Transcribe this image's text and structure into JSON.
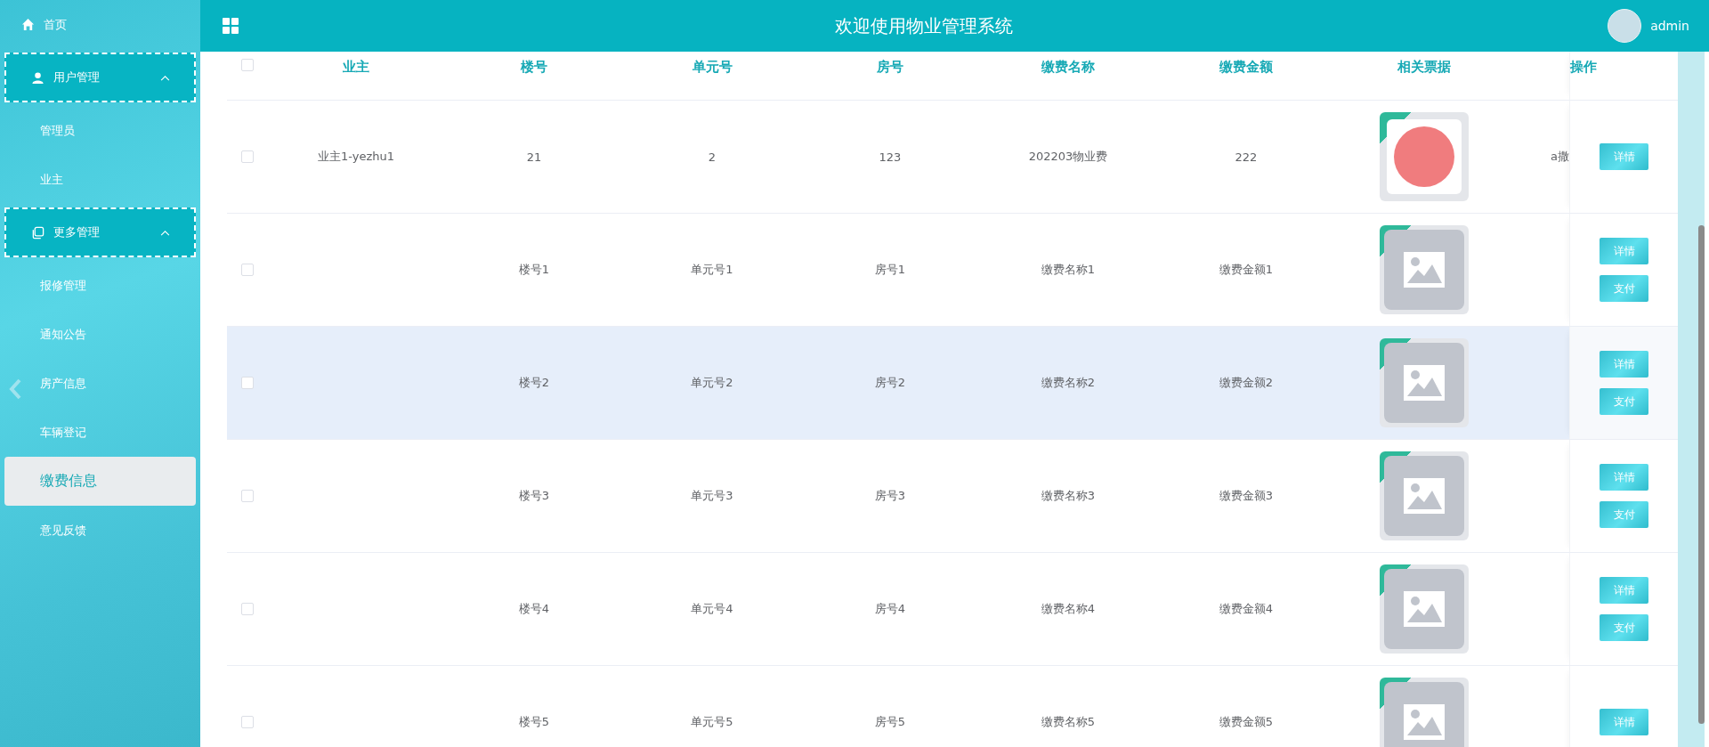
{
  "sidebar": {
    "home": {
      "label": "首页"
    },
    "groups": [
      {
        "label": "用户管理",
        "expanded": true,
        "children": [
          {
            "label": "管理员",
            "selected": false
          },
          {
            "label": "业主",
            "selected": false
          }
        ]
      },
      {
        "label": "更多管理",
        "expanded": true,
        "children": [
          {
            "label": "报修管理",
            "selected": false
          },
          {
            "label": "通知公告",
            "selected": false
          },
          {
            "label": "房产信息",
            "selected": false
          },
          {
            "label": "车辆登记",
            "selected": false
          },
          {
            "label": "缴费信息",
            "selected": true
          },
          {
            "label": "意见反馈",
            "selected": false
          }
        ]
      }
    ]
  },
  "header": {
    "title": "欢迎使用物业管理系统",
    "user": "admin"
  },
  "table": {
    "select_all": {
      "checked": false
    },
    "columns": [
      "业主",
      "楼号",
      "单元号",
      "房号",
      "缴费名称",
      "缴费金额",
      "相关票据"
    ],
    "action_column": "操作",
    "rows": [
      {
        "checked": false,
        "highlighted": false,
        "cells": [
          "业主1-yezhu1",
          "21",
          "2",
          "123",
          "202203物业费",
          "222"
        ],
        "receipt_uploaded": true,
        "column_9": "a撒",
        "actions": [
          "详情"
        ]
      },
      {
        "checked": false,
        "highlighted": false,
        "cells": [
          "",
          "楼号1",
          "单元号1",
          "房号1",
          "缴费名称1",
          "缴费金额1"
        ],
        "receipt_uploaded": false,
        "actions": [
          "详情",
          "支付"
        ]
      },
      {
        "checked": false,
        "highlighted": true,
        "cells": [
          "",
          "楼号2",
          "单元号2",
          "房号2",
          "缴费名称2",
          "缴费金额2"
        ],
        "receipt_uploaded": false,
        "actions": [
          "详情",
          "支付"
        ]
      },
      {
        "checked": false,
        "highlighted": false,
        "cells": [
          "",
          "楼号3",
          "单元号3",
          "房号3",
          "缴费名称3",
          "缴费金额3"
        ],
        "receipt_uploaded": false,
        "actions": [
          "详情",
          "支付"
        ]
      },
      {
        "checked": false,
        "highlighted": false,
        "cells": [
          "",
          "楼号4",
          "单元号4",
          "房号4",
          "缴费名称4",
          "缴费金额4"
        ],
        "receipt_uploaded": false,
        "actions": [
          "详情",
          "支付"
        ]
      },
      {
        "checked": false,
        "highlighted": false,
        "cells": [
          "",
          "楼号5",
          "单元号5",
          "房号5",
          "缴费名称5",
          "缴费金额5"
        ],
        "receipt_uploaded": false,
        "actions": [
          "详情"
        ]
      }
    ]
  }
}
